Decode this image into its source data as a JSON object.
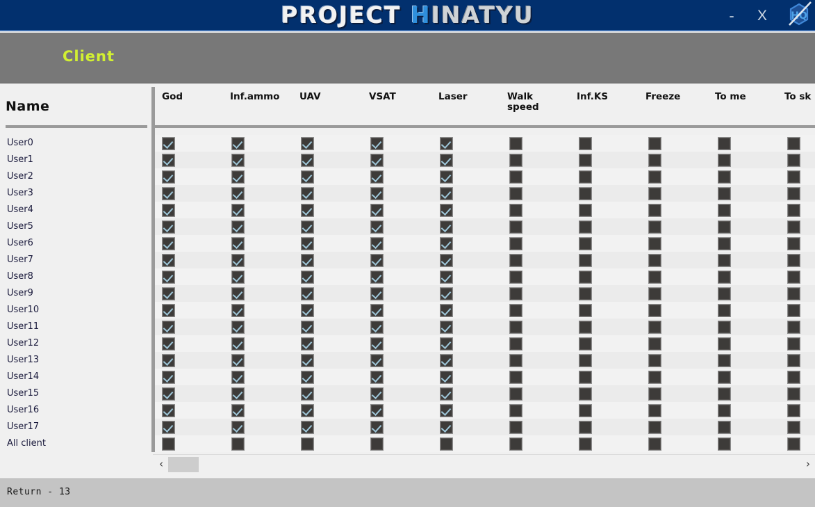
{
  "window": {
    "title_part1": "PROJECT ",
    "title_h": "H",
    "title_part2": "INATYU",
    "minimize_label": "-",
    "close_label": "X",
    "logo_icon": "hexagon-hq-logo-icon",
    "titlebar_color": "#02306e",
    "accent_color": "#2f8fdc"
  },
  "tabs": {
    "items": [
      {
        "label": "Client",
        "active": true
      }
    ],
    "active_color": "#d2f032",
    "bar_color": "#787878"
  },
  "grid": {
    "name_header": "Name",
    "columns": [
      "God",
      "Inf.ammo",
      "UAV",
      "VSAT",
      "Laser",
      "Walk\nspeed",
      "Inf.KS",
      "Freeze",
      "To me",
      "To sk"
    ],
    "rows": [
      {
        "name": "User0",
        "checks": [
          true,
          true,
          true,
          true,
          true,
          false,
          false,
          false,
          false,
          false
        ]
      },
      {
        "name": "User1",
        "checks": [
          true,
          true,
          true,
          true,
          true,
          false,
          false,
          false,
          false,
          false
        ]
      },
      {
        "name": "User2",
        "checks": [
          true,
          true,
          true,
          true,
          true,
          false,
          false,
          false,
          false,
          false
        ]
      },
      {
        "name": "User3",
        "checks": [
          true,
          true,
          true,
          true,
          true,
          false,
          false,
          false,
          false,
          false
        ]
      },
      {
        "name": "User4",
        "checks": [
          true,
          true,
          true,
          true,
          true,
          false,
          false,
          false,
          false,
          false
        ]
      },
      {
        "name": "User5",
        "checks": [
          true,
          true,
          true,
          true,
          true,
          false,
          false,
          false,
          false,
          false
        ]
      },
      {
        "name": "User6",
        "checks": [
          true,
          true,
          true,
          true,
          true,
          false,
          false,
          false,
          false,
          false
        ]
      },
      {
        "name": "User7",
        "checks": [
          true,
          true,
          true,
          true,
          true,
          false,
          false,
          false,
          false,
          false
        ]
      },
      {
        "name": "User8",
        "checks": [
          true,
          true,
          true,
          true,
          true,
          false,
          false,
          false,
          false,
          false
        ]
      },
      {
        "name": "User9",
        "checks": [
          true,
          true,
          true,
          true,
          true,
          false,
          false,
          false,
          false,
          false
        ]
      },
      {
        "name": "User10",
        "checks": [
          true,
          true,
          true,
          true,
          true,
          false,
          false,
          false,
          false,
          false
        ]
      },
      {
        "name": "User11",
        "checks": [
          true,
          true,
          true,
          true,
          true,
          false,
          false,
          false,
          false,
          false
        ]
      },
      {
        "name": "User12",
        "checks": [
          true,
          true,
          true,
          true,
          true,
          false,
          false,
          false,
          false,
          false
        ]
      },
      {
        "name": "User13",
        "checks": [
          true,
          true,
          true,
          true,
          true,
          false,
          false,
          false,
          false,
          false
        ]
      },
      {
        "name": "User14",
        "checks": [
          true,
          true,
          true,
          true,
          true,
          false,
          false,
          false,
          false,
          false
        ]
      },
      {
        "name": "User15",
        "checks": [
          true,
          true,
          true,
          true,
          true,
          false,
          false,
          false,
          false,
          false
        ]
      },
      {
        "name": "User16",
        "checks": [
          true,
          true,
          true,
          true,
          true,
          false,
          false,
          false,
          false,
          false
        ]
      },
      {
        "name": "User17",
        "checks": [
          true,
          true,
          true,
          true,
          true,
          false,
          false,
          false,
          false,
          false
        ]
      },
      {
        "name": "All client",
        "checks": [
          false,
          false,
          false,
          false,
          false,
          false,
          false,
          false,
          false,
          false
        ]
      }
    ],
    "checkbox_color": "#3d3b39",
    "check_mark_color": "#9ec6d8"
  },
  "scrollbar": {
    "left_arrow": "‹",
    "right_arrow": "›"
  },
  "status": {
    "text": "Return - 13"
  }
}
